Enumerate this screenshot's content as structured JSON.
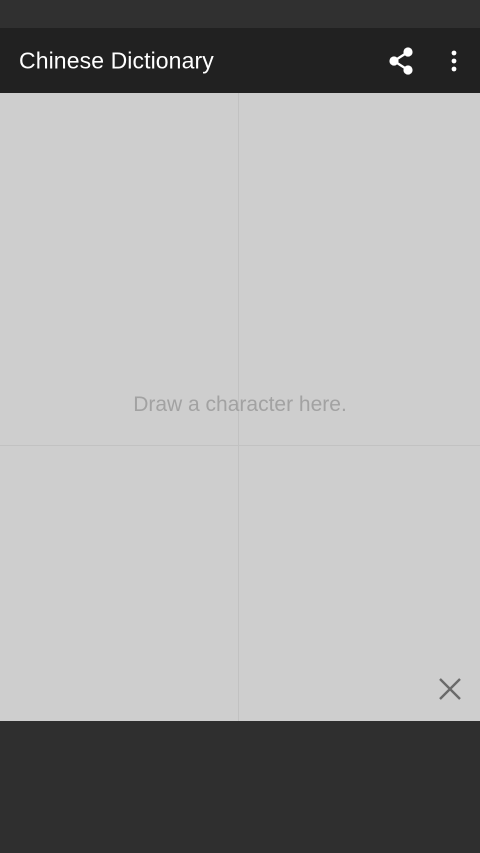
{
  "app_bar": {
    "title": "Chinese Dictionary",
    "background": "#212121",
    "actions": [
      {
        "name": "share",
        "icon": "share-icon"
      },
      {
        "name": "more-options",
        "icon": "more-vertical-icon"
      }
    ]
  },
  "drawing_pad": {
    "hint": "Draw a character here.",
    "background": "#cecece",
    "clear_icon": "close-icon"
  },
  "colors": {
    "status_bar": "#303030",
    "bottom_area": "#2f2f2f",
    "hint_text": "#a2a2a2",
    "icon_light": "#ffffff",
    "icon_dark": "#6a6a6a"
  }
}
